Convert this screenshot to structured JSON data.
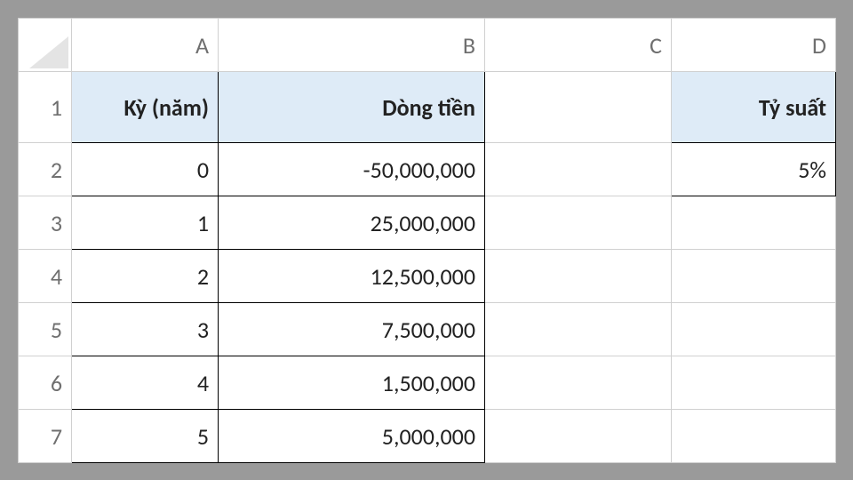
{
  "columns": {
    "A": "A",
    "B": "B",
    "C": "C",
    "D": "D"
  },
  "rows": {
    "r1": "1",
    "r2": "2",
    "r3": "3",
    "r4": "4",
    "r5": "5",
    "r6": "6",
    "r7": "7"
  },
  "headers": {
    "period": "Kỳ (năm)",
    "cashflow": "Dòng tiền",
    "rate": "Tỷ suất"
  },
  "table": {
    "rows": [
      {
        "period": "0",
        "cashflow": "-50,000,000"
      },
      {
        "period": "1",
        "cashflow": "25,000,000"
      },
      {
        "period": "2",
        "cashflow": "12,500,000"
      },
      {
        "period": "3",
        "cashflow": "7,500,000"
      },
      {
        "period": "4",
        "cashflow": "1,500,000"
      },
      {
        "period": "5",
        "cashflow": "5,000,000"
      }
    ]
  },
  "rate": {
    "value": "5%"
  }
}
